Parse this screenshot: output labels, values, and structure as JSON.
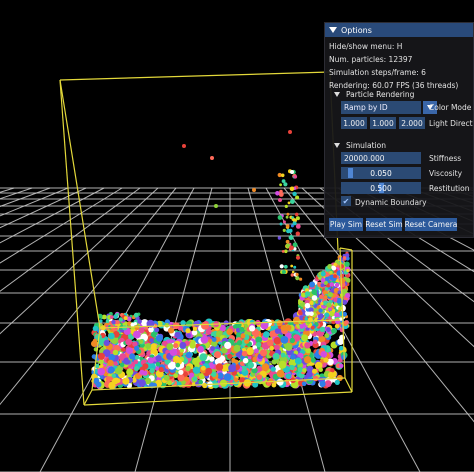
{
  "window": {
    "title": "Options",
    "hide_show_menu": "Hide/show menu: H",
    "num_particles": "Num. particles: 12397",
    "sim_steps": "Simulation steps/frame: 6",
    "rendering": "Rendering: 60.07 FPS (36 threads)"
  },
  "particle_rendering": {
    "header": "Particle Rendering",
    "color_mode_value": "Ramp by ID",
    "color_mode_label": "Color Mode",
    "light_dir": [
      "1.000",
      "1.000",
      "2.000"
    ],
    "light_dir_label": "Light Direct"
  },
  "simulation": {
    "header": "Simulation",
    "stiffness_value": "20000.000",
    "stiffness_label": "Stiffness",
    "viscosity_value": "0.050",
    "viscosity_label": "Viscosity",
    "viscosity_fraction": 0.05,
    "restitution_value": "0.500",
    "restitution_label": "Restitution",
    "restitution_fraction": 0.5,
    "dynamic_boundary_label": "Dynamic Boundary",
    "dynamic_boundary_checked": true
  },
  "buttons": {
    "play": "Play Sim",
    "reset_sim": "Reset Sim",
    "reset_camera": "Reset Camera"
  },
  "colors": {
    "titlebar": "#294a7a",
    "frame_bg": "#2b4a74",
    "button": "#2c5a9c",
    "boundary_box": "#e3d83a",
    "grid": "#d0d0d0"
  }
}
